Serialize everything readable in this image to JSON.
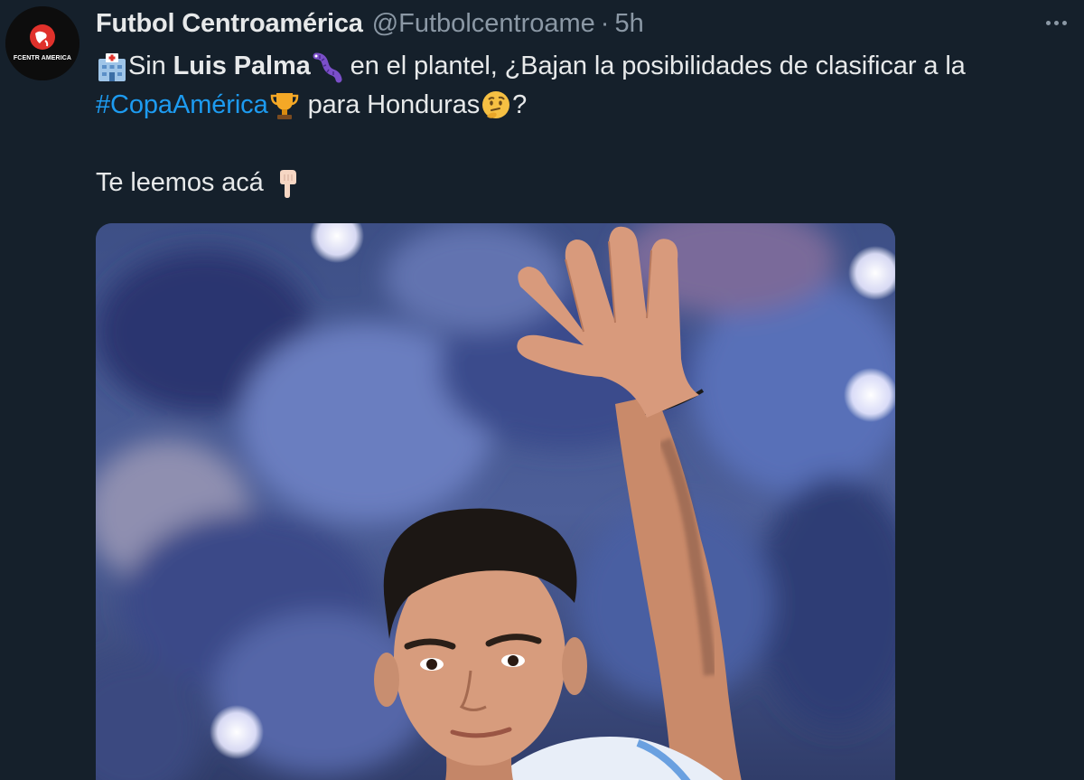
{
  "tweet": {
    "display_name": "Futbol Centroamérica",
    "handle": "@Futbolcentroame",
    "separator": "·",
    "time": "5h",
    "avatar_text": "FCENTR  AMERICA",
    "text": {
      "line1_a": "Sin ",
      "line1_bold": "Luis Palma",
      "line1_b": " en el plantel, ¿Bajan la posibilidades de clasificar a la",
      "line2_hashtag": "#CopaAmérica",
      "line2_a": " para Honduras",
      "line2_b": "?",
      "line3": "Te leemos acá "
    },
    "icons": {
      "hospital": "hospital-emoji",
      "worm": "worm-emoji",
      "trophy": "trophy-emoji",
      "thinking": "thinking-face-emoji",
      "pointing": "backhand-index-pointing-down-emoji",
      "more": "more-icon"
    }
  },
  "colors": {
    "background": "#15202b",
    "text": "#e7e9ea",
    "secondary": "#8b98a5",
    "link": "#1d9bf0"
  }
}
